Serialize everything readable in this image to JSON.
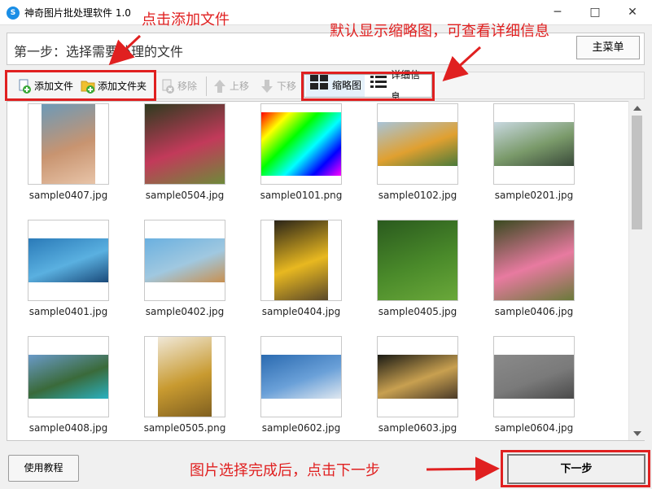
{
  "window": {
    "title": "神奇图片批处理软件 1.0",
    "app_icon_glyph": "S",
    "minimize_glyph": "─",
    "maximize_glyph": "□",
    "close_glyph": "✕"
  },
  "step": {
    "text": "第一步：选择需要处理的文件",
    "main_menu_label": "主菜单"
  },
  "toolbar": {
    "add_file": "添加文件",
    "add_folder": "添加文件夹",
    "remove": "移除",
    "move_up": "上移",
    "move_down": "下移",
    "thumbnail_view": "缩略图",
    "detail_view": "详细信息"
  },
  "files": [
    {
      "name": "sample0407.jpg",
      "colors": [
        "#6c9ab8",
        "#c89470",
        "#e8c4a8"
      ]
    },
    {
      "name": "sample0504.jpg",
      "colors": [
        "#2d3b1e",
        "#c23a5a",
        "#6e8a3a"
      ]
    },
    {
      "name": "sample0101.png",
      "colors": [
        "#ff0000",
        "#00ff00",
        "#0000ff"
      ]
    },
    {
      "name": "sample0102.jpg",
      "colors": [
        "#a8c4d8",
        "#e0a030",
        "#4a7a3a"
      ]
    },
    {
      "name": "sample0201.jpg",
      "colors": [
        "#c8d8e0",
        "#7a9a6a",
        "#3a4a3a"
      ]
    },
    {
      "name": "sample0401.jpg",
      "colors": [
        "#2a7ab8",
        "#5ab0e0",
        "#1a4a7a"
      ]
    },
    {
      "name": "sample0402.jpg",
      "colors": [
        "#6ab0e0",
        "#a0c8e0",
        "#c89050"
      ]
    },
    {
      "name": "sample0404.jpg",
      "colors": [
        "#2a2418",
        "#e8b820",
        "#5a4828"
      ]
    },
    {
      "name": "sample0405.jpg",
      "colors": [
        "#2a5a1e",
        "#4a8a2a",
        "#6aa83a"
      ]
    },
    {
      "name": "sample0406.jpg",
      "colors": [
        "#3a4a20",
        "#e87aa0",
        "#6a7a3a"
      ]
    },
    {
      "name": "sample0408.jpg",
      "colors": [
        "#6a9ac8",
        "#3a6a3a",
        "#2ab0c0"
      ]
    },
    {
      "name": "sample0505.png",
      "colors": [
        "#f0e8d8",
        "#c89a30",
        "#806020"
      ]
    },
    {
      "name": "sample0602.jpg",
      "colors": [
        "#2a6ab0",
        "#6aa0d8",
        "#e0e8f0"
      ]
    },
    {
      "name": "sample0603.jpg",
      "colors": [
        "#1a1a14",
        "#c8a050",
        "#4a3a28"
      ]
    },
    {
      "name": "sample0604.jpg",
      "colors": [
        "#8a8a8a",
        "#7a7a7a",
        "#4a4a4a"
      ]
    }
  ],
  "bottom": {
    "tutorial_label": "使用教程",
    "next_label": "下一步"
  },
  "annotations": {
    "click_add": "点击添加文件",
    "default_thumbnail": "默认显示缩略图，可查看详细信息",
    "click_next": "图片选择完成后，点击下一步"
  },
  "colors": {
    "annotation_red": "#e02020",
    "accent_blue": "#1a8ee6"
  }
}
